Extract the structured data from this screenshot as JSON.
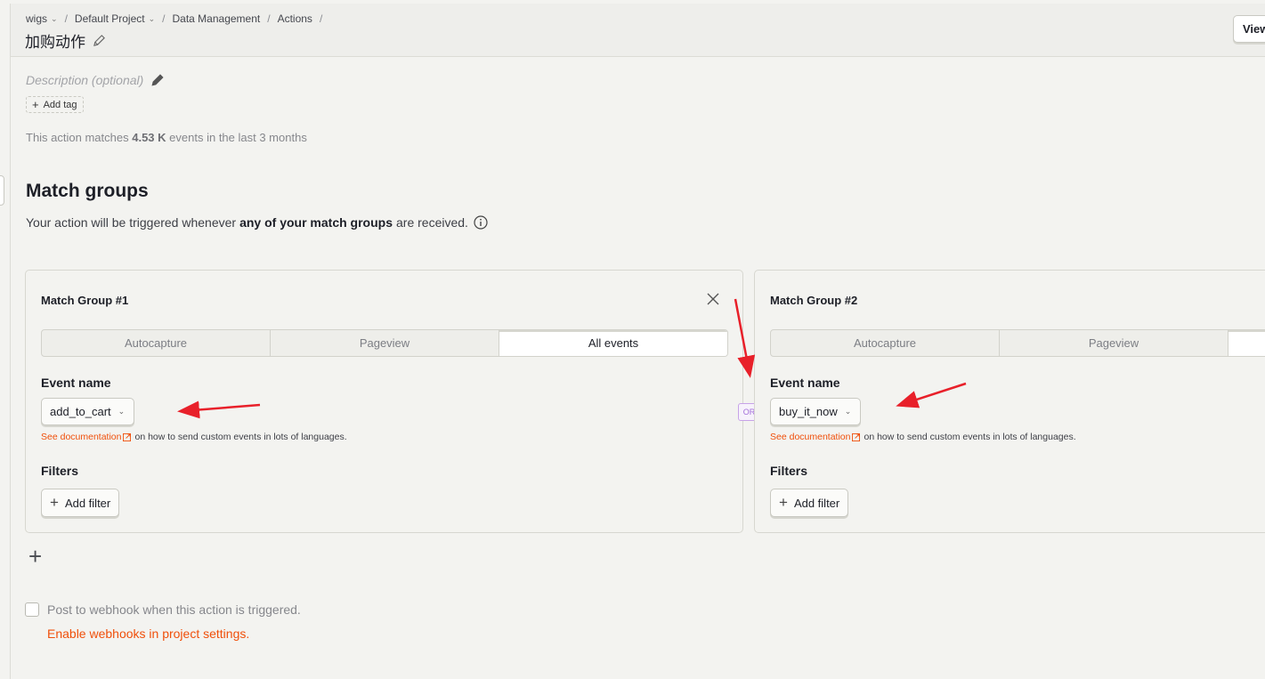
{
  "breadcrumb": {
    "org": "wigs",
    "project": "Default Project",
    "section": "Data Management",
    "page": "Actions",
    "separator": "/"
  },
  "title": "加购动作",
  "header": {
    "view_button": "View"
  },
  "description_placeholder": "Description (optional)",
  "add_tag_label": "Add tag",
  "matches": {
    "prefix": "This action matches",
    "count": "4.53 K",
    "suffix": "events in the last 3 months"
  },
  "match_groups": {
    "heading": "Match groups",
    "subtitle_prefix": "Your action will be triggered whenever",
    "subtitle_bold": "any of your match groups",
    "subtitle_suffix": "are received.",
    "or_label": "OR",
    "groups": [
      {
        "title": "Match Group #1",
        "tabs": [
          "Autocapture",
          "Pageview",
          "All events"
        ],
        "active_tab": "All events",
        "event_name_label": "Event name",
        "event_name": "add_to_cart",
        "doc_link": "See documentation",
        "doc_text": "on how to send custom events in lots of languages.",
        "filters_label": "Filters",
        "add_filter": "Add filter"
      },
      {
        "title": "Match Group #2",
        "tabs": [
          "Autocapture",
          "Pageview",
          ""
        ],
        "active_tab": "",
        "event_name_label": "Event name",
        "event_name": "buy_it_now",
        "doc_link": "See documentation",
        "doc_text": "on how to send custom events in lots of languages.",
        "filters_label": "Filters",
        "add_filter": "Add filter"
      }
    ]
  },
  "webhook": {
    "checkbox_label": "Post to webhook when this action is triggered.",
    "checked": false,
    "settings_link": "Enable webhooks in project settings."
  },
  "colors": {
    "background": "#f3f3f0",
    "accent_link": "#f04f0a",
    "or_badge": "#a36ed9",
    "annotation_arrow": "#e8202a"
  },
  "icons": [
    "chevron-down-icon",
    "pencil-icon",
    "plus-icon",
    "info-icon",
    "close-icon",
    "external-link-icon",
    "annotation-arrow"
  ]
}
